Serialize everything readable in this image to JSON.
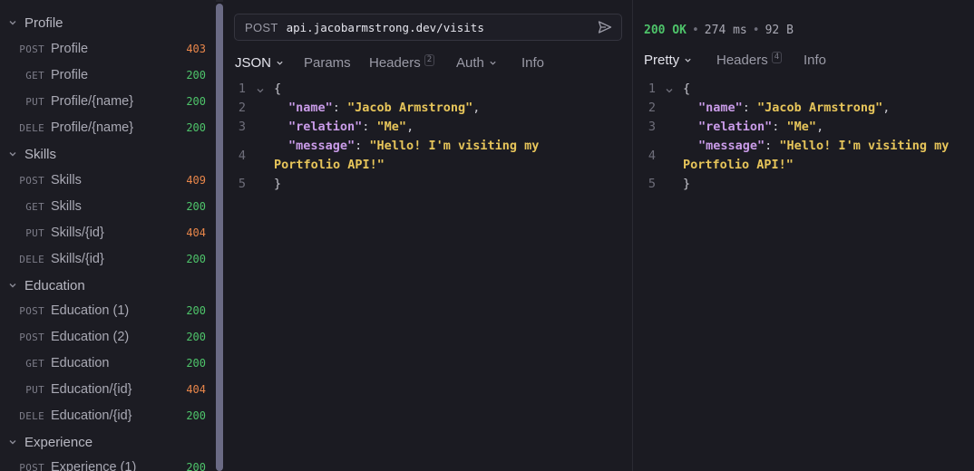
{
  "sidebar": {
    "folders": [
      {
        "name": "Profile",
        "requests": [
          {
            "method": "POST",
            "name": "Profile",
            "status": "403"
          },
          {
            "method": "GET",
            "name": "Profile",
            "status": "200"
          },
          {
            "method": "PUT",
            "name": "Profile/{name}",
            "status": "200"
          },
          {
            "method": "DELE",
            "name": "Profile/{name}",
            "status": "200"
          }
        ]
      },
      {
        "name": "Skills",
        "requests": [
          {
            "method": "POST",
            "name": "Skills",
            "status": "409"
          },
          {
            "method": "GET",
            "name": "Skills",
            "status": "200"
          },
          {
            "method": "PUT",
            "name": "Skills/{id}",
            "status": "404"
          },
          {
            "method": "DELE",
            "name": "Skills/{id}",
            "status": "200"
          }
        ]
      },
      {
        "name": "Education",
        "requests": [
          {
            "method": "POST",
            "name": "Education (1)",
            "status": "200"
          },
          {
            "method": "POST",
            "name": "Education (2)",
            "status": "200"
          },
          {
            "method": "GET",
            "name": "Education",
            "status": "200"
          },
          {
            "method": "PUT",
            "name": "Education/{id}",
            "status": "404"
          },
          {
            "method": "DELE",
            "name": "Education/{id}",
            "status": "200"
          }
        ]
      },
      {
        "name": "Experience",
        "requests": [
          {
            "method": "POST",
            "name": "Experience (1)",
            "status": "200"
          }
        ]
      }
    ]
  },
  "request": {
    "method": "POST",
    "url": "api.jacobarmstrong.dev/visits",
    "tabs": {
      "body": "JSON",
      "params": "Params",
      "headers": "Headers",
      "headers_count": "2",
      "auth": "Auth",
      "info": "Info"
    },
    "body_lines": [
      "1",
      "2",
      "3",
      "4",
      "5"
    ],
    "body": {
      "open": "{",
      "name_key": "\"name\"",
      "name_val": "\"Jacob Armstrong\"",
      "relation_key": "\"relation\"",
      "relation_val": "\"Me\"",
      "message_key": "\"message\"",
      "message_val_1": "\"Hello! I'm visiting my",
      "message_val_2": "Portfolio API!\"",
      "close": "}"
    }
  },
  "response": {
    "status": "200 OK",
    "time": "274 ms",
    "size": "92 B",
    "tabs": {
      "body": "Pretty",
      "headers": "Headers",
      "headers_count": "4",
      "info": "Info"
    },
    "body_lines": [
      "1",
      "2",
      "3",
      "4",
      "5"
    ],
    "body": {
      "open": "{",
      "name_key": "\"name\"",
      "name_val": "\"Jacob Armstrong\"",
      "relation_key": "\"relation\"",
      "relation_val": "\"Me\"",
      "message_key": "\"message\"",
      "message_val_1": "\"Hello! I'm visiting my",
      "message_val_2": "Portfolio API!\"",
      "close": "}"
    }
  },
  "icons": {
    "folder_chevron": "chevron-down-icon",
    "send": "send-icon",
    "dropdown": "chevron-down-icon",
    "fold": "chevron-down-icon"
  },
  "colors": {
    "status_success": "#4ec46a",
    "status_error": "#e8864a",
    "json_key": "#c99be8",
    "json_string": "#e7c55a"
  }
}
